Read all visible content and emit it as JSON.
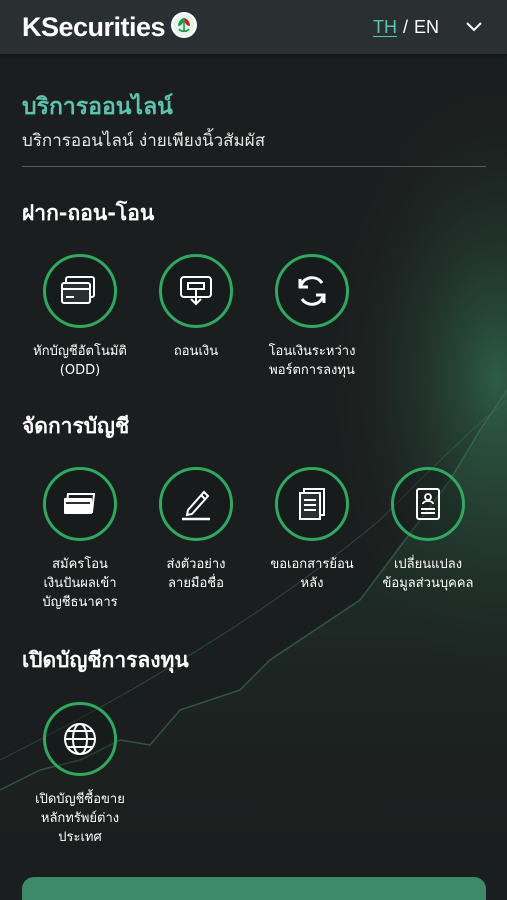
{
  "header": {
    "brand_name": "KSecurities",
    "lang_th": "TH",
    "lang_separator": "/",
    "lang_en": "EN"
  },
  "page": {
    "title": "บริการออนไลน์",
    "subtitle": "บริการออนไลน์ ง่ายเพียงนิ้วสัมผัส"
  },
  "sections": [
    {
      "title": "ฝาก-ถอน-โอน",
      "items": [
        {
          "label": "หักบัญชีอัตโนมัติ\n(ODD)",
          "icon": "card-icon"
        },
        {
          "label": "ถอนเงิน",
          "icon": "withdraw-icon"
        },
        {
          "label": "โอนเงินระหว่าง\nพอร์ตการลงทุน",
          "icon": "transfer-icon"
        }
      ]
    },
    {
      "title": "จัดการบัญชี",
      "items": [
        {
          "label": "สมัครโอน\nเงินปันผลเข้า\nบัญชีธนาคาร",
          "icon": "bank-card-icon"
        },
        {
          "label": "ส่งตัวอย่าง\nลายมือชื่อ",
          "icon": "signature-pen-icon"
        },
        {
          "label": "ขอเอกสารย้อน\nหลัง",
          "icon": "documents-icon"
        },
        {
          "label": "เปลี่ยนแปลง\nข้อมูลส่วนบุคคล",
          "icon": "profile-card-icon"
        }
      ]
    },
    {
      "title": "เปิดบัญชีการลงทุน",
      "items": [
        {
          "label": "เปิดบัญชีซื้อขาย\nหลักทรัพย์ต่าง\nประเทศ",
          "icon": "globe-icon"
        }
      ]
    }
  ],
  "colors": {
    "accent": "#5cc3ae",
    "icon_ring": "#2fa860",
    "background": "#1b1e1e",
    "header_bg": "#2a2f31"
  }
}
